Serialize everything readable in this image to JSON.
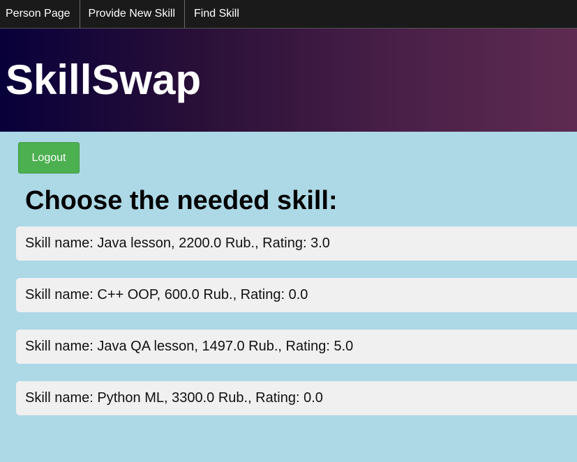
{
  "nav": {
    "items": [
      {
        "label": "Person Page"
      },
      {
        "label": "Provide New Skill"
      },
      {
        "label": "Find Skill"
      }
    ]
  },
  "header": {
    "title": "SkillSwap"
  },
  "logout_label": "Logout",
  "heading": "Choose the needed skill:",
  "skills": [
    {
      "text": "Skill name: Java lesson, 2200.0 Rub., Rating: 3.0"
    },
    {
      "text": "Skill name: C++ OOP, 600.0 Rub., Rating: 0.0"
    },
    {
      "text": "Skill name: Java QA lesson, 1497.0 Rub., Rating: 5.0"
    },
    {
      "text": "Skill name: Python ML, 3300.0 Rub., Rating: 0.0"
    }
  ],
  "colors": {
    "background": "#add8e6",
    "navbar": "#1a1a1a",
    "logout_button": "#4caf50",
    "skill_item": "#f0f0f0"
  }
}
